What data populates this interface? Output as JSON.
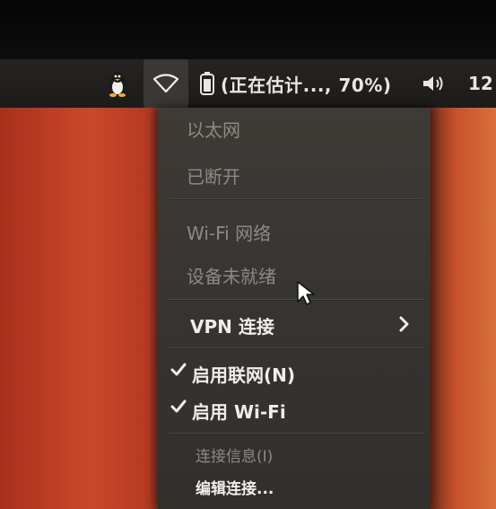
{
  "topbar": {
    "battery_text": "(正在估计..., 70%)",
    "clock": "12"
  },
  "icons": {
    "tux": "tux-penguin-icon",
    "network": "wifi-network-icon",
    "battery": "battery-icon",
    "volume": "volume-icon"
  },
  "menu": {
    "ethernet_header": "以太网",
    "ethernet_status": "已断开",
    "wifi_header": "Wi-Fi 网络",
    "wifi_status": "设备未就绪",
    "vpn": "VPN 连接",
    "enable_networking": "启用联网(N)",
    "enable_wifi": "启用 Wi-Fi",
    "connection_info": "连接信息(I)",
    "edit_connections": "编辑连接..."
  }
}
